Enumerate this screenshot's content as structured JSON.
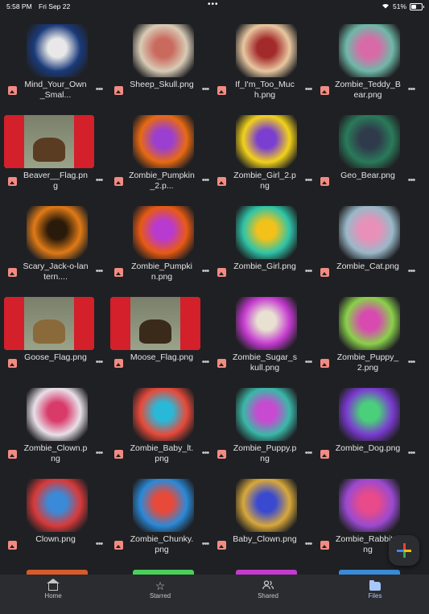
{
  "status_bar": {
    "time": "5:58 PM",
    "date": "Fri Sep 22",
    "battery": "51%",
    "battery_level": 0.51
  },
  "files": [
    {
      "name": "Mind_Your_Own_Smal...",
      "thumb": "square",
      "colors": [
        "#1a3a7a",
        "#e8e8e8"
      ]
    },
    {
      "name": "Sheep_Skull.png",
      "thumb": "square",
      "colors": [
        "#d8cbb5",
        "#c96a5e"
      ]
    },
    {
      "name": "If_I'm_Too_Much.png",
      "thumb": "square",
      "colors": [
        "#e8c7a0",
        "#a22a2a"
      ]
    },
    {
      "name": "Zombie_Teddy_Bear.png",
      "thumb": "square",
      "colors": [
        "#6fb8a8",
        "#d96aa8"
      ]
    },
    {
      "name": "Beaver__Flag.png",
      "thumb": "flag",
      "colors": [
        "#d3202a",
        "#5a3c22"
      ]
    },
    {
      "name": "Zombie_Pumpkin_2.p...",
      "thumb": "square",
      "colors": [
        "#e86a12",
        "#9a3fd0"
      ]
    },
    {
      "name": "Zombie_Girl_2.png",
      "thumb": "square",
      "colors": [
        "#f2d21a",
        "#7a3fd0"
      ]
    },
    {
      "name": "Geo_Bear.png",
      "thumb": "square",
      "colors": [
        "#2a7a5a",
        "#2f3a4a"
      ]
    },
    {
      "name": "Scary_Jack-o-lantern....",
      "thumb": "square",
      "colors": [
        "#e07a16",
        "#2a1a0a"
      ]
    },
    {
      "name": "Zombie_Pumpkin.png",
      "thumb": "square",
      "colors": [
        "#e85a12",
        "#b83ad0"
      ]
    },
    {
      "name": "Zombie_Girl.png",
      "thumb": "square",
      "colors": [
        "#2ec4a8",
        "#f2c21a"
      ]
    },
    {
      "name": "Zombie_Cat.png",
      "thumb": "square",
      "colors": [
        "#9ab8c8",
        "#e890b8"
      ]
    },
    {
      "name": "Goose_Flag.png",
      "thumb": "flag",
      "colors": [
        "#d3202a",
        "#8a6a3a"
      ]
    },
    {
      "name": "Moose_Flag.png",
      "thumb": "flag",
      "colors": [
        "#d3202a",
        "#3a2a1a"
      ]
    },
    {
      "name": "Zombie_Sugar_skull.png",
      "thumb": "square",
      "colors": [
        "#c43ad0",
        "#e8e0d0"
      ]
    },
    {
      "name": "Zombie_Puppy_2.png",
      "thumb": "square",
      "colors": [
        "#8ad04a",
        "#d84ab0"
      ]
    },
    {
      "name": "Zombie_Clown.png",
      "thumb": "square",
      "colors": [
        "#e8e0e8",
        "#d83a6a"
      ]
    },
    {
      "name": "Zombie_Baby_lt.png",
      "thumb": "square",
      "colors": [
        "#e84a3a",
        "#2ab8d8"
      ]
    },
    {
      "name": "Zombie_Puppy.png",
      "thumb": "square",
      "colors": [
        "#3ab8a8",
        "#c84ad0"
      ]
    },
    {
      "name": "Zombie_Dog.png",
      "thumb": "square",
      "colors": [
        "#7a3ad0",
        "#4ad07a"
      ]
    },
    {
      "name": "Clown.png",
      "thumb": "square",
      "colors": [
        "#d83a3a",
        "#3a8ad8"
      ]
    },
    {
      "name": "Zombie_Chunky.png",
      "thumb": "square",
      "colors": [
        "#2a8ad8",
        "#e84a3a"
      ]
    },
    {
      "name": "Baby_Clown.png",
      "thumb": "square",
      "colors": [
        "#d8a83a",
        "#3a4ad0"
      ]
    },
    {
      "name": "Zombie_Rabbit.png",
      "thumb": "square",
      "colors": [
        "#9a4ad0",
        "#e84a8a"
      ]
    }
  ],
  "peek_colors": [
    "#d85a2a",
    "#4ad05a",
    "#c43ad0",
    "#3a8ad8"
  ],
  "fab": {
    "icon": "plus-icon"
  },
  "bottom_nav": [
    {
      "label": "Home",
      "icon": "home-icon",
      "active": false
    },
    {
      "label": "Starred",
      "icon": "star-icon",
      "active": false
    },
    {
      "label": "Shared",
      "icon": "people-icon",
      "active": false
    },
    {
      "label": "Files",
      "icon": "folder-icon",
      "active": true
    }
  ]
}
